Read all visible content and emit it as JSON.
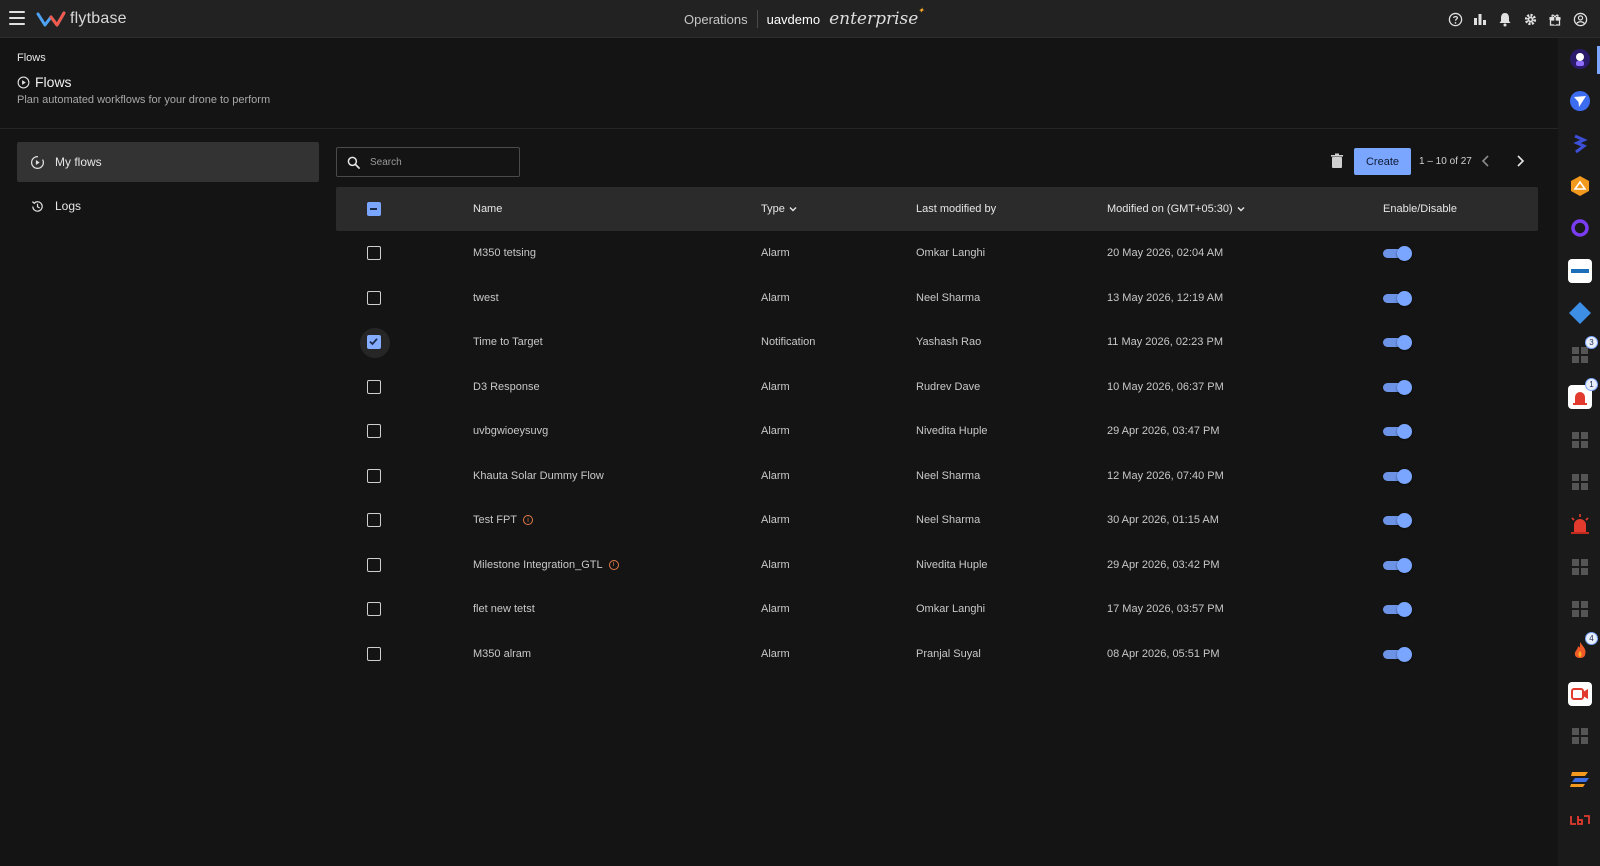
{
  "topbar": {
    "logo_text": "flytbase",
    "section": "Operations",
    "org": "uavdemo",
    "plan": "enterprise",
    "icons": [
      "help-icon",
      "analytics-icon",
      "notification-bell-icon",
      "settings-gear-icon",
      "gift-icon",
      "user-account-icon"
    ]
  },
  "header": {
    "breadcrumb": "Flows",
    "title": "Flows",
    "subtitle": "Plan automated workflows for your drone to perform"
  },
  "nav": {
    "items": [
      {
        "label": "My flows",
        "icon": "flows-icon",
        "active": true
      },
      {
        "label": "Logs",
        "icon": "history-icon",
        "active": false
      }
    ]
  },
  "toolbar": {
    "search_placeholder": "Search",
    "create_label": "Create",
    "pagination": "1 – 10 of 27"
  },
  "table": {
    "columns": {
      "name": "Name",
      "type": "Type",
      "modified_by": "Last modified by",
      "modified_on": "Modified on (GMT+05:30)",
      "enable": "Enable/Disable"
    },
    "rows": [
      {
        "name": "M350 tetsing",
        "type": "Alarm",
        "modified_by": "Omkar Langhi",
        "modified_on": "20 May 2026, 02:04 AM",
        "checked": false,
        "info": false,
        "enabled": true
      },
      {
        "name": "twest",
        "type": "Alarm",
        "modified_by": "Neel Sharma",
        "modified_on": "13 May 2026, 12:19 AM",
        "checked": false,
        "info": false,
        "enabled": true
      },
      {
        "name": "Time to Target",
        "type": "Notification",
        "modified_by": "Yashash Rao",
        "modified_on": "11 May 2026, 02:23 PM",
        "checked": true,
        "info": false,
        "enabled": true
      },
      {
        "name": "D3 Response",
        "type": "Alarm",
        "modified_by": "Rudrev Dave",
        "modified_on": "10 May 2026, 06:37 PM",
        "checked": false,
        "info": false,
        "enabled": true
      },
      {
        "name": "uvbgwioeysuvg",
        "type": "Alarm",
        "modified_by": "Nivedita Huple",
        "modified_on": "29 Apr 2026, 03:47 PM",
        "checked": false,
        "info": false,
        "enabled": true
      },
      {
        "name": "Khauta Solar Dummy Flow",
        "type": "Alarm",
        "modified_by": "Neel Sharma",
        "modified_on": "12 May 2026, 07:40 PM",
        "checked": false,
        "info": false,
        "enabled": true
      },
      {
        "name": "Test FPT",
        "type": "Alarm",
        "modified_by": "Neel Sharma",
        "modified_on": "30 Apr 2026, 01:15 AM",
        "checked": false,
        "info": true,
        "enabled": true
      },
      {
        "name": "Milestone Integration_GTL",
        "type": "Alarm",
        "modified_by": "Nivedita Huple",
        "modified_on": "29 Apr 2026, 03:42 PM",
        "checked": false,
        "info": true,
        "enabled": true
      },
      {
        "name": "flet new tetst",
        "type": "Alarm",
        "modified_by": "Omkar Langhi",
        "modified_on": "17 May 2026, 03:57 PM",
        "checked": false,
        "info": false,
        "enabled": true
      },
      {
        "name": "M350 alram",
        "type": "Alarm",
        "modified_by": "Pranjal Suyal",
        "modified_on": "08 Apr 2026, 05:51 PM",
        "checked": false,
        "info": false,
        "enabled": true
      }
    ]
  },
  "rail": {
    "apps": [
      {
        "icon": "astronaut-app-icon",
        "color": "#3a1f7a",
        "badge": ""
      },
      {
        "icon": "send-app-icon",
        "color": "#3c6df0",
        "badge": ""
      },
      {
        "icon": "sword-app-icon",
        "color": "#1a1a1a",
        "badge": ""
      },
      {
        "icon": "hex-app-icon",
        "color": "#f39a1e",
        "badge": ""
      },
      {
        "icon": "ring-app-icon",
        "color": "#1a1a1a",
        "badge": ""
      },
      {
        "icon": "genetec-app-icon",
        "color": "#ffffff",
        "badge": ""
      },
      {
        "icon": "diamond-app-icon",
        "color": "#1a1a1a",
        "badge": ""
      },
      {
        "icon": "grid-app-icon",
        "color": "#2a2a2a",
        "badge": "3"
      },
      {
        "icon": "siren-app-icon",
        "color": "#ffffff",
        "badge": "1"
      },
      {
        "icon": "grid-app-icon",
        "color": "#2a2a2a",
        "badge": ""
      },
      {
        "icon": "grid-app-icon",
        "color": "#2a2a2a",
        "badge": ""
      },
      {
        "icon": "alarm-light-app-icon",
        "color": "#1a1a1a",
        "badge": ""
      },
      {
        "icon": "grid-app-icon",
        "color": "#2a2a2a",
        "badge": ""
      },
      {
        "icon": "grid-app-icon",
        "color": "#2a2a2a",
        "badge": ""
      },
      {
        "icon": "flame-app-icon",
        "color": "#1a1a1a",
        "badge": "4"
      },
      {
        "icon": "video-app-icon",
        "color": "#ffffff",
        "badge": ""
      },
      {
        "icon": "grid-app-icon",
        "color": "#2a2a2a",
        "badge": ""
      },
      {
        "icon": "stripes-app-icon",
        "color": "#1a1a1a",
        "badge": ""
      },
      {
        "icon": "brand-app-icon",
        "color": "#1a1a1a",
        "badge": ""
      }
    ]
  }
}
